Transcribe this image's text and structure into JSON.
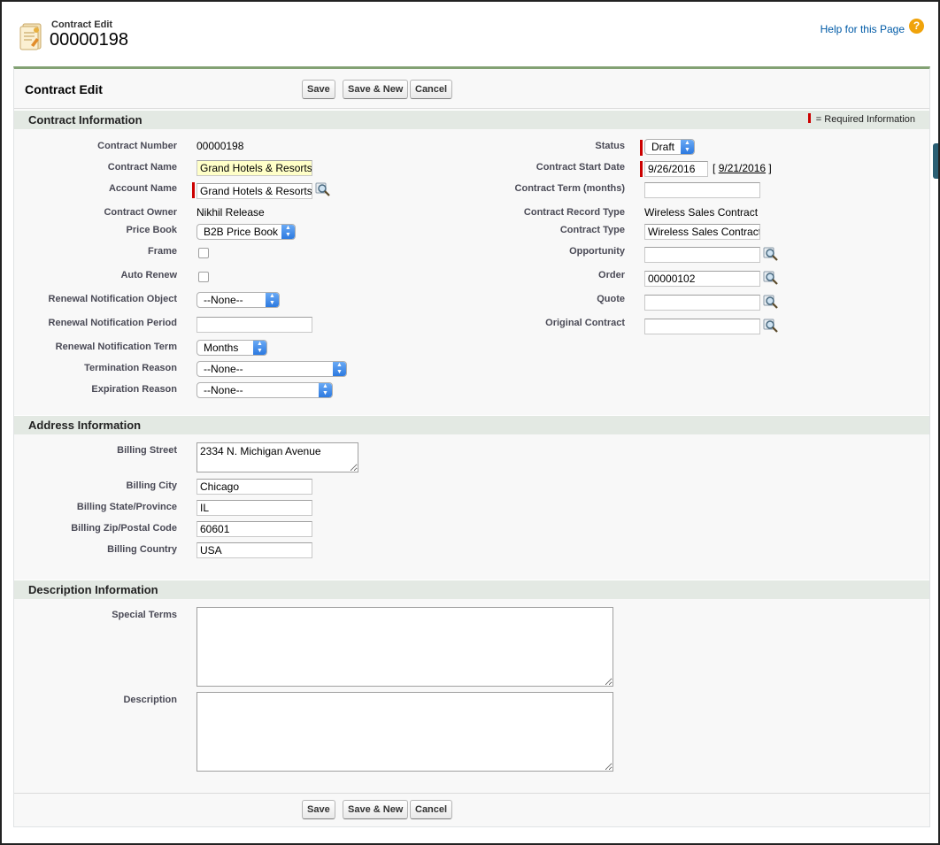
{
  "header": {
    "record_type": "Contract Edit",
    "record_name": "00000198",
    "help_link": "Help for this Page",
    "help_icon": "question-circle-icon"
  },
  "block": {
    "title": "Contract Edit",
    "buttons": {
      "save": "Save",
      "save_new": "Save & New",
      "cancel": "Cancel"
    }
  },
  "sections": {
    "contract": {
      "title": "Contract Information",
      "required_legend": "= Required Information"
    },
    "address": {
      "title": "Address Information"
    },
    "description": {
      "title": "Description Information"
    }
  },
  "left_fields": {
    "contract_number": {
      "label": "Contract Number",
      "value": "00000198"
    },
    "contract_name": {
      "label": "Contract Name",
      "value": "Grand Hotels & Resorts"
    },
    "account_name": {
      "label": "Account Name",
      "value": "Grand Hotels & Resorts"
    },
    "contract_owner": {
      "label": "Contract Owner",
      "value": "Nikhil Release"
    },
    "price_book": {
      "label": "Price Book",
      "value": "B2B Price Book"
    },
    "frame": {
      "label": "Frame"
    },
    "auto_renew": {
      "label": "Auto Renew"
    },
    "renewal_notification_object": {
      "label": "Renewal Notification Object",
      "value": "--None--"
    },
    "renewal_notification_period": {
      "label": "Renewal Notification Period",
      "value": ""
    },
    "renewal_notification_term": {
      "label": "Renewal Notification Term",
      "value": "Months"
    },
    "termination_reason": {
      "label": "Termination Reason",
      "value": "--None--"
    },
    "expiration_reason": {
      "label": "Expiration Reason",
      "value": "--None--"
    }
  },
  "right_fields": {
    "status": {
      "label": "Status",
      "value": "Draft"
    },
    "contract_start_date": {
      "label": "Contract Start Date",
      "value": "9/26/2016",
      "today_open": "[",
      "today_link": "9/21/2016",
      "today_close": "]"
    },
    "contract_term": {
      "label": "Contract Term (months)",
      "value": ""
    },
    "contract_record_type": {
      "label": "Contract Record Type",
      "value": "Wireless Sales Contract"
    },
    "contract_type": {
      "label": "Contract Type",
      "value": "Wireless Sales Contract"
    },
    "opportunity": {
      "label": "Opportunity",
      "value": ""
    },
    "order": {
      "label": "Order",
      "value": "00000102"
    },
    "quote": {
      "label": "Quote",
      "value": ""
    },
    "original_contract": {
      "label": "Original Contract",
      "value": ""
    }
  },
  "address_fields": {
    "billing_street": {
      "label": "Billing Street",
      "value": "2334 N. Michigan Avenue"
    },
    "billing_city": {
      "label": "Billing City",
      "value": "Chicago"
    },
    "billing_state": {
      "label": "Billing State/Province",
      "value": "IL"
    },
    "billing_zip": {
      "label": "Billing Zip/Postal Code",
      "value": "60601"
    },
    "billing_country": {
      "label": "Billing Country",
      "value": "USA"
    }
  },
  "description_fields": {
    "special_terms": {
      "label": "Special Terms",
      "value": ""
    },
    "description": {
      "label": "Description",
      "value": ""
    }
  },
  "colors": {
    "accent": "#82a173",
    "section_bg": "#e3e9e3",
    "required": "#cc0000",
    "link": "#015ba7",
    "help_icon": "#f0a30a",
    "select_arrow": "#2c79e0"
  },
  "icons": {
    "record": "contract-document-icon",
    "lookup": "lookup-magnifier-icon",
    "select": "chevron-updown-icon"
  }
}
